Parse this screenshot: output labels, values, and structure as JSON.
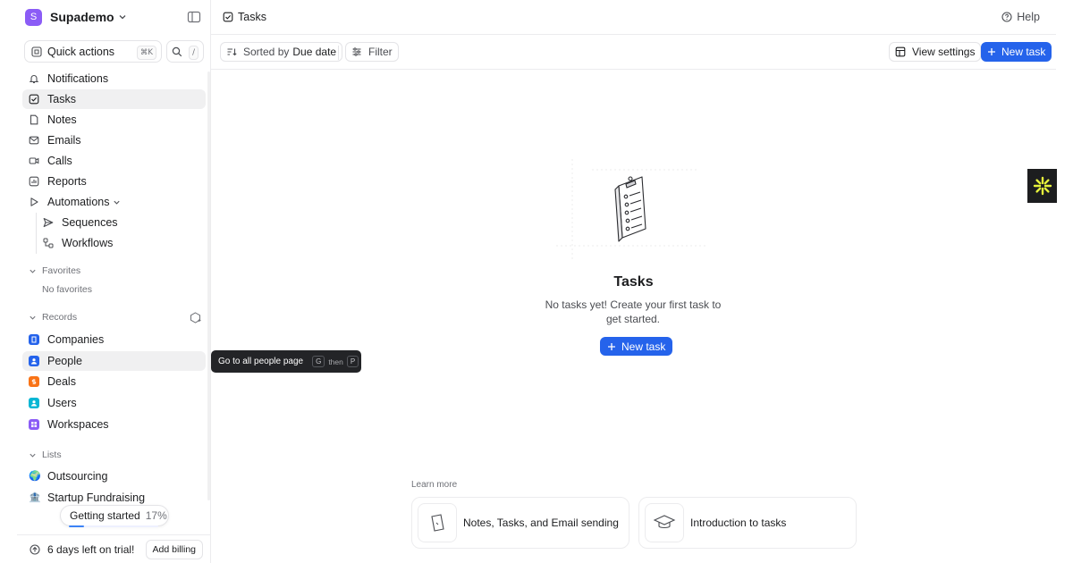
{
  "workspace": {
    "initial": "S",
    "name": "Supademo"
  },
  "quick_actions": {
    "label": "Quick actions",
    "shortcut": "⌘K",
    "search_shortcut": "/"
  },
  "nav": {
    "items": [
      {
        "label": "Notifications"
      },
      {
        "label": "Tasks"
      },
      {
        "label": "Notes"
      },
      {
        "label": "Emails"
      },
      {
        "label": "Calls"
      },
      {
        "label": "Reports"
      },
      {
        "label": "Automations"
      }
    ],
    "sub_items": [
      {
        "label": "Sequences"
      },
      {
        "label": "Workflows"
      }
    ]
  },
  "favorites": {
    "title": "Favorites",
    "empty": "No favorites"
  },
  "records": {
    "title": "Records",
    "items": [
      {
        "label": "Companies",
        "color": "#2563eb"
      },
      {
        "label": "People",
        "color": "#2563eb"
      },
      {
        "label": "Deals",
        "color": "#f97316"
      },
      {
        "label": "Users",
        "color": "#06b6d4"
      },
      {
        "label": "Workspaces",
        "color": "#8b5cf6"
      }
    ]
  },
  "lists": {
    "title": "Lists",
    "items": [
      {
        "label": "Outsourcing",
        "icon": "🌍"
      },
      {
        "label": "Startup Fundraising",
        "icon": "🏦"
      }
    ]
  },
  "getting_started": {
    "label": "Getting started",
    "percent": "17%",
    "progress": 0.17
  },
  "trial": {
    "text": "6 days left on trial!",
    "button": "Add billing"
  },
  "topbar": {
    "title": "Tasks",
    "help": "Help"
  },
  "toolbar": {
    "sorted_prefix": "Sorted by",
    "sorted_value": "Due date",
    "filter": "Filter",
    "view_settings": "View settings",
    "new_task": "New task"
  },
  "empty_state": {
    "title": "Tasks",
    "description": "No tasks yet! Create your first task to get started.",
    "cta": "New task"
  },
  "learn_more": {
    "title": "Learn more",
    "cards": [
      {
        "label": "Notes, Tasks, and Email sending"
      },
      {
        "label": "Introduction to tasks"
      }
    ]
  },
  "tooltip": {
    "text": "Go to all people page",
    "key1": "G",
    "then": "then",
    "key2": "P"
  },
  "colors": {
    "accent": "#2563eb",
    "workspace": "#8b5cf6",
    "widget_bg": "#1c1d1f",
    "widget_icon": "#e6f23c"
  }
}
